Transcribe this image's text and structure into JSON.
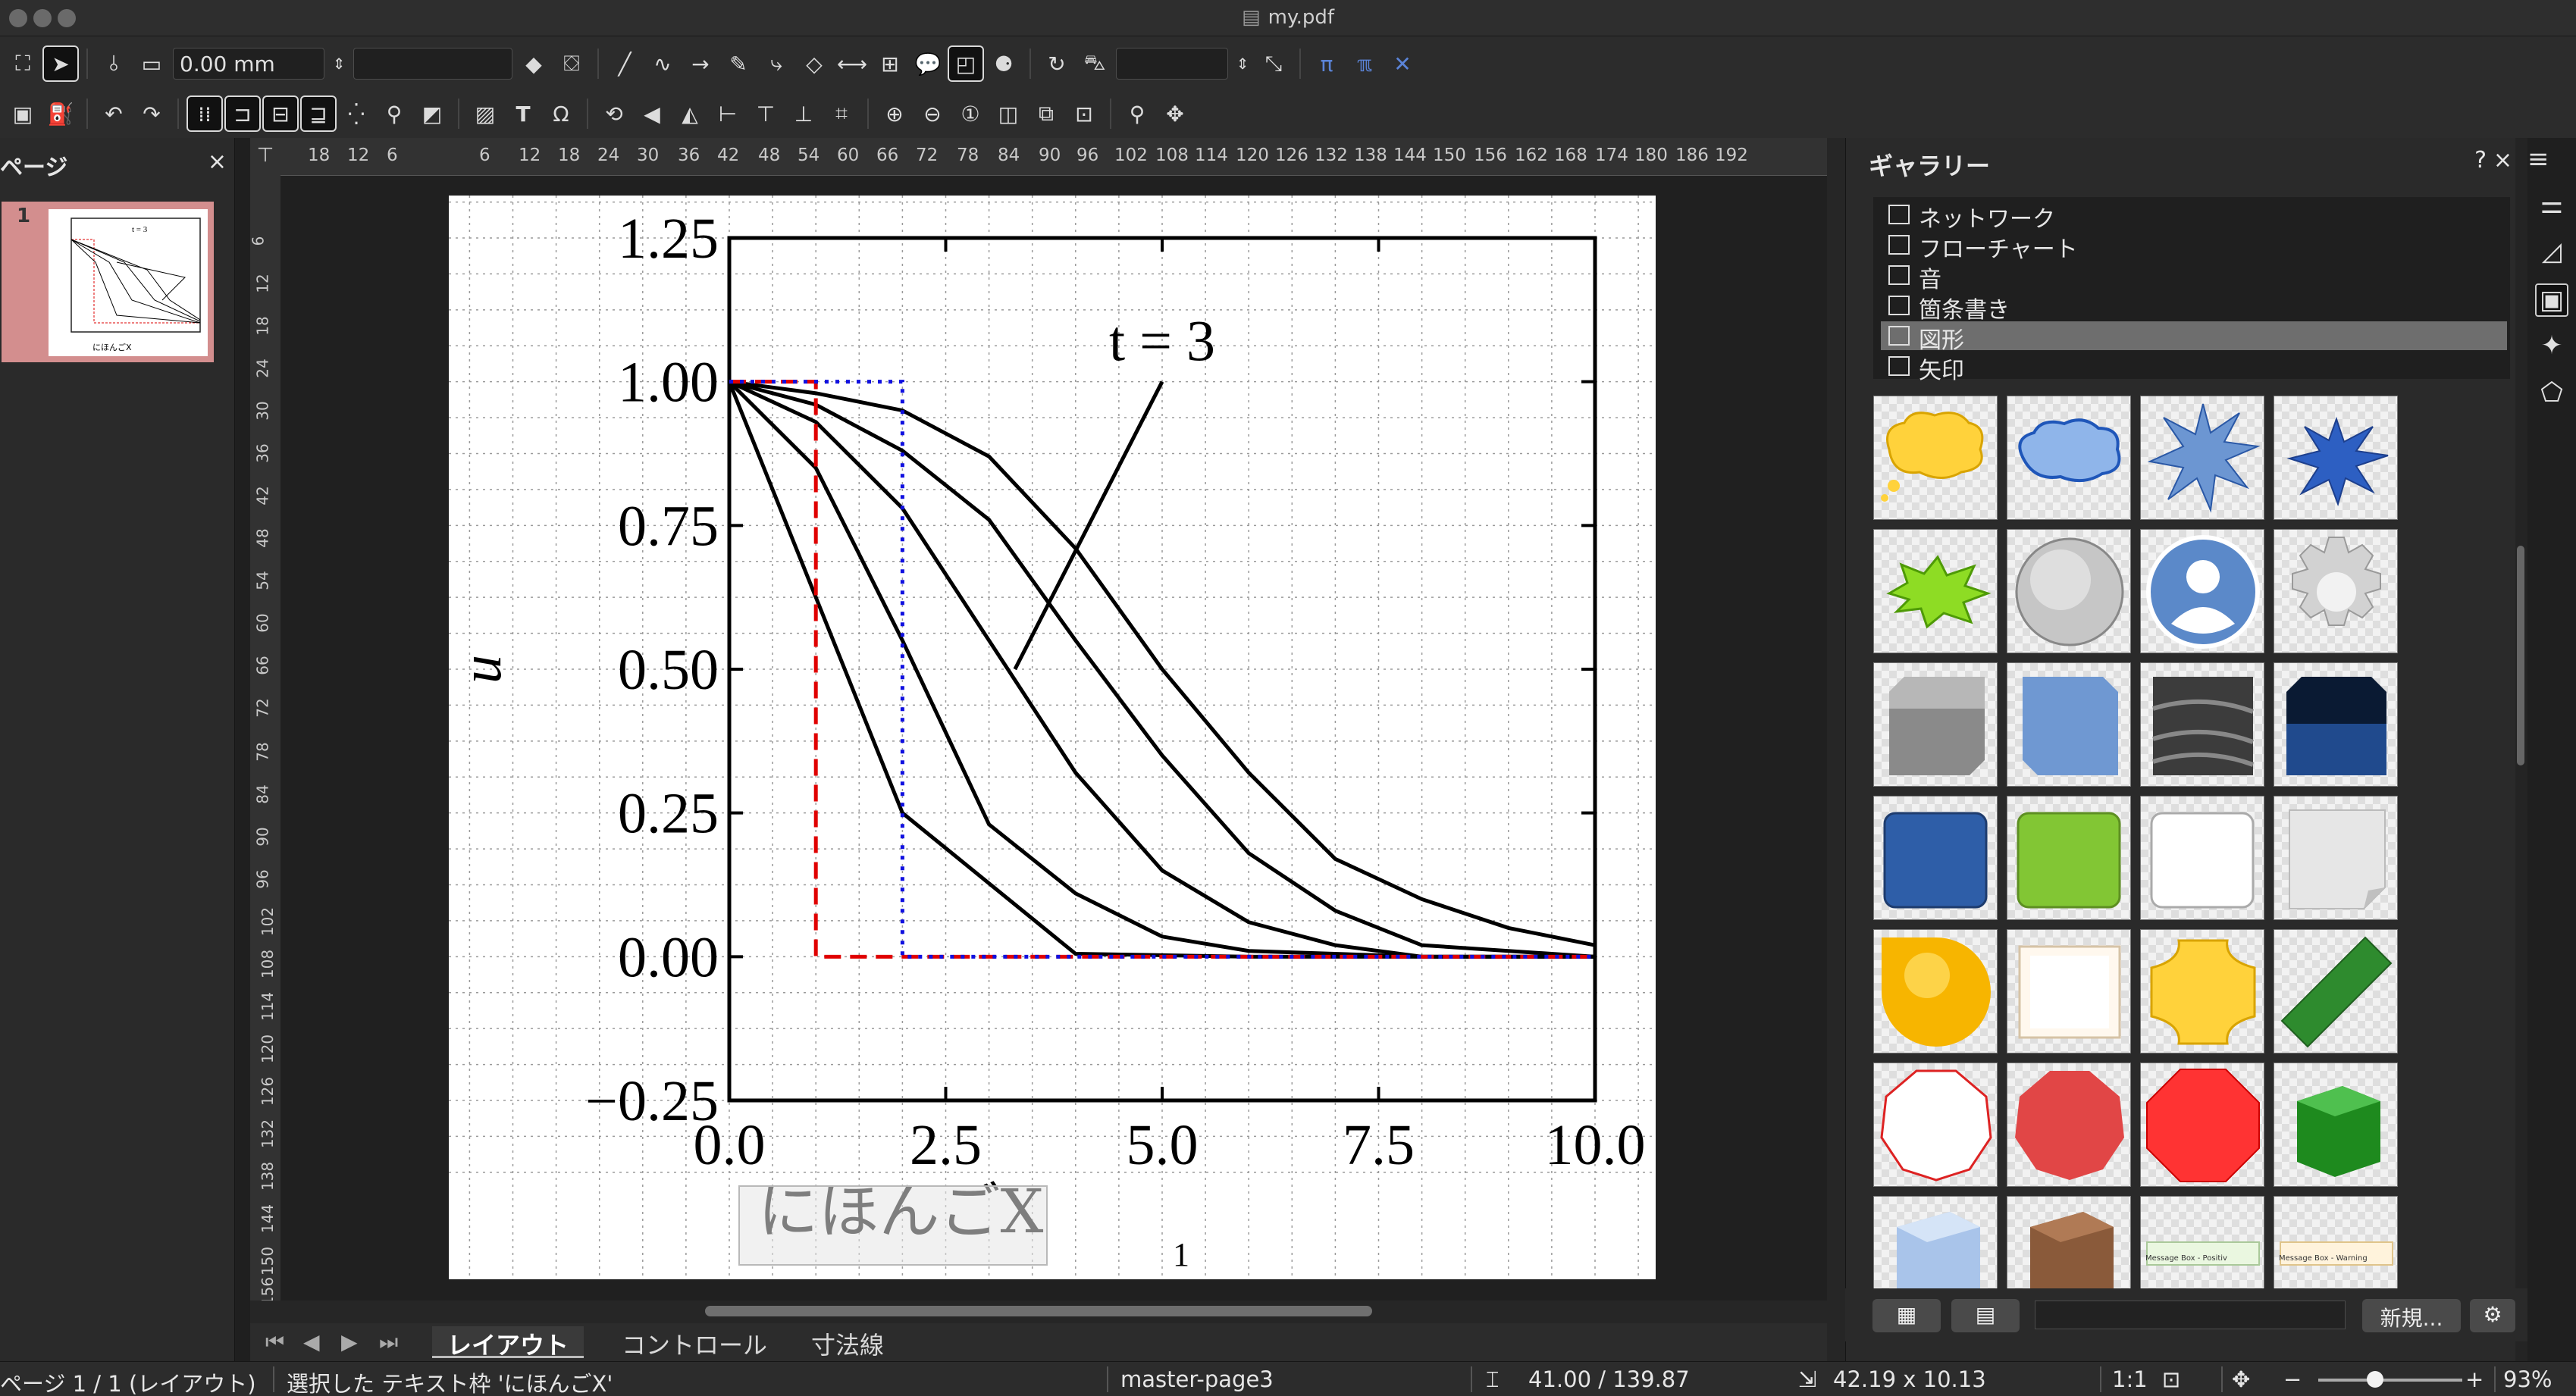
{
  "window": {
    "title": "my.pdf"
  },
  "toolbar1": {
    "line_width": "0.00 mm",
    "line_style": "",
    "transparency": ""
  },
  "pages_panel": {
    "title": "ページ",
    "close": "×",
    "thumbnail_number": "1"
  },
  "ruler": {
    "top": [
      "18",
      "12",
      "6",
      "6",
      "12",
      "18",
      "24",
      "30",
      "36",
      "42",
      "48",
      "54",
      "60",
      "66",
      "72",
      "78",
      "84",
      "90",
      "96",
      "102",
      "108",
      "114",
      "120",
      "126",
      "132",
      "138",
      "144",
      "150",
      "156",
      "162",
      "168",
      "174",
      "180",
      "186",
      "192"
    ],
    "left": [
      "6",
      "12",
      "18",
      "24",
      "30",
      "36",
      "42",
      "48",
      "54",
      "60",
      "66",
      "72",
      "78",
      "84",
      "90",
      "96",
      "102",
      "108",
      "114",
      "120",
      "126",
      "132",
      "138",
      "144",
      "150",
      "156"
    ]
  },
  "document": {
    "page_number": "1",
    "xlabel_textbox": "にほんごX"
  },
  "chart_data": {
    "type": "line",
    "title": "",
    "xlabel": "にほんごX",
    "ylabel": "u",
    "xlim": [
      0,
      10
    ],
    "ylim": [
      -0.25,
      1.25
    ],
    "grid": true,
    "xticks": [
      "0.0",
      "2.5",
      "5.0",
      "7.5",
      "10.0"
    ],
    "yticks": [
      "1.25",
      "1.00",
      "0.75",
      "0.50",
      "0.25",
      "0.00",
      "−0.25"
    ],
    "annotation": {
      "text": "t = 3",
      "xy": [
        3.3,
        0.5
      ],
      "xytext": [
        5.0,
        1.0
      ]
    },
    "series": [
      {
        "style": "solid-black",
        "x": [
          0,
          2,
          4,
          6,
          8,
          10
        ],
        "y": [
          1.0,
          0.25,
          0.005,
          0.0,
          0.0,
          0.0
        ]
      },
      {
        "style": "solid-black",
        "x": [
          0,
          1,
          2,
          3,
          4,
          5,
          6,
          8,
          10
        ],
        "y": [
          1.0,
          0.85,
          0.55,
          0.23,
          0.11,
          0.035,
          0.01,
          0.0,
          0.0
        ]
      },
      {
        "style": "solid-black",
        "x": [
          0,
          1,
          2,
          3,
          4,
          5,
          6,
          7,
          8,
          10
        ],
        "y": [
          1.0,
          0.93,
          0.78,
          0.55,
          0.32,
          0.15,
          0.06,
          0.02,
          0.0,
          0.0
        ]
      },
      {
        "style": "solid-black",
        "x": [
          0,
          1,
          2,
          3,
          4,
          5,
          6,
          7,
          8,
          10
        ],
        "y": [
          1.0,
          0.96,
          0.88,
          0.76,
          0.55,
          0.35,
          0.18,
          0.08,
          0.02,
          0.0
        ]
      },
      {
        "style": "solid-black",
        "x": [
          0,
          1,
          2,
          3,
          4,
          5,
          6,
          7,
          8,
          9,
          10
        ],
        "y": [
          1.0,
          0.98,
          0.95,
          0.87,
          0.71,
          0.5,
          0.32,
          0.17,
          0.1,
          0.05,
          0.02
        ]
      },
      {
        "style": "dashed-red",
        "x": [
          0,
          1,
          1,
          10
        ],
        "y": [
          1.0,
          1.0,
          0.0,
          0.0
        ]
      },
      {
        "style": "dotted-blue",
        "x": [
          0,
          2,
          2,
          10
        ],
        "y": [
          1.0,
          1.0,
          0.0,
          0.0
        ]
      }
    ]
  },
  "tabs": [
    "レイアウト",
    "コントロール",
    "寸法線"
  ],
  "gallery": {
    "title": "ギャラリー",
    "help": "?",
    "close": "×",
    "themes": [
      "ネットワーク",
      "フローチャート",
      "音",
      "箇条書き",
      "図形",
      "矢印"
    ],
    "selected_theme": "図形",
    "new_button": "新規...",
    "thumb_captions": [
      "Message Box - Positiv",
      "Message Box - Warning"
    ]
  },
  "status": {
    "page": "ページ 1 / 1 (レイアウト)",
    "selection": "選択した テキスト枠 'にほんごX'",
    "master": "master-page3",
    "position": "41.00 / 139.87",
    "size": "42.19 x 10.13",
    "scale": "1:1",
    "zoom": "93%"
  },
  "colors": {
    "accent_selection": "#d38e8e",
    "red_dashed": "#e00000",
    "blue_dotted": "#1010e0"
  }
}
